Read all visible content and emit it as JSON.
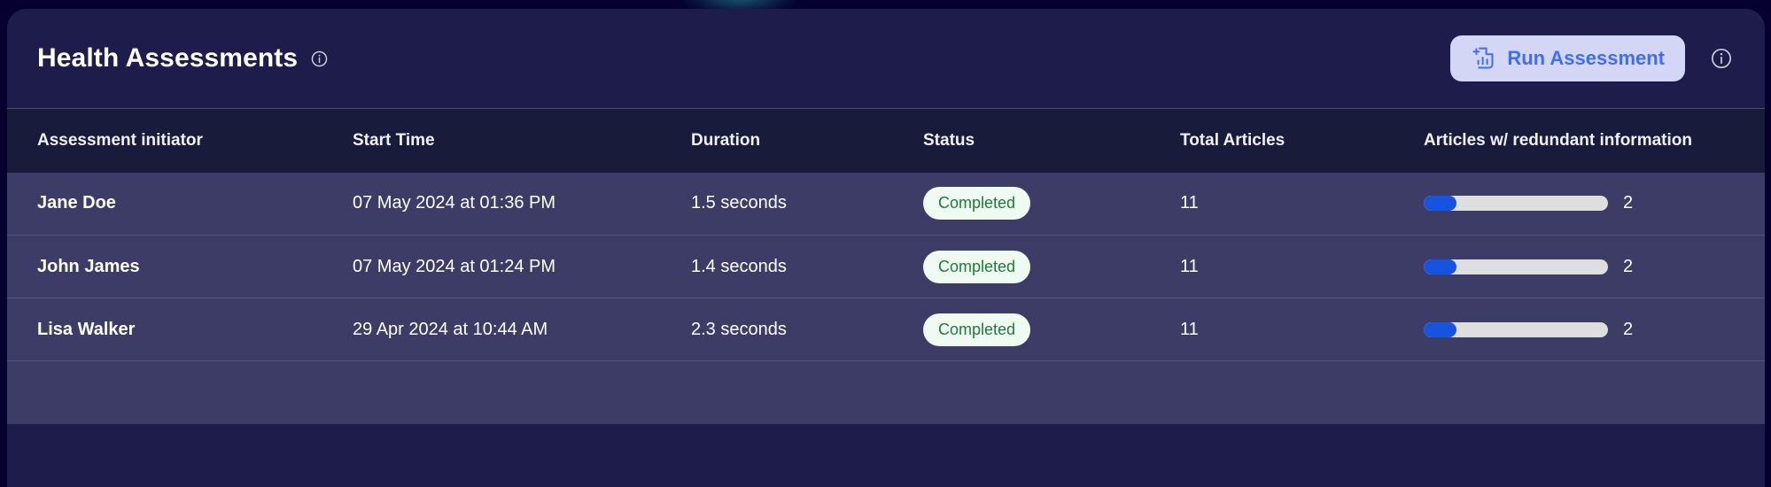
{
  "header": {
    "title": "Health Assessments",
    "title_info_icon": "info-icon",
    "run_button": {
      "label": "Run Assessment",
      "icon": "add-chart-icon"
    },
    "trailing_info_icon": "info-icon"
  },
  "table": {
    "columns": [
      "Assessment initiator",
      "Start Time",
      "Duration",
      "Status",
      "Total Articles",
      "Articles w/ redundant information"
    ],
    "rows": [
      {
        "initiator": "Jane Doe",
        "start_time": "07 May 2024 at 01:36 PM",
        "duration": "1.5 seconds",
        "status": "Completed",
        "total_articles": "11",
        "redundant_count": "2",
        "redundant_percent": 18
      },
      {
        "initiator": "John James",
        "start_time": "07 May 2024 at 01:24 PM",
        "duration": "1.4 seconds",
        "status": "Completed",
        "total_articles": "11",
        "redundant_count": "2",
        "redundant_percent": 18
      },
      {
        "initiator": "Lisa Walker",
        "start_time": "29 Apr 2024 at 10:44 AM",
        "duration": "2.3 seconds",
        "status": "Completed",
        "total_articles": "11",
        "redundant_count": "2",
        "redundant_percent": 18
      }
    ]
  },
  "colors": {
    "page_background": "#05002e",
    "card_background": "#1d1c4a",
    "table_header_background": "#181b3a",
    "row_background": "#3c3c66",
    "row_divider": "#565480",
    "accent_blue": "#3f6ef0",
    "button_background": "#d4d6f6",
    "badge_background": "#effaf0",
    "badge_text": "#1e7a3c",
    "progress_fill": "#1553e0",
    "progress_track": "#dedede",
    "text_primary": "#ffffff"
  }
}
